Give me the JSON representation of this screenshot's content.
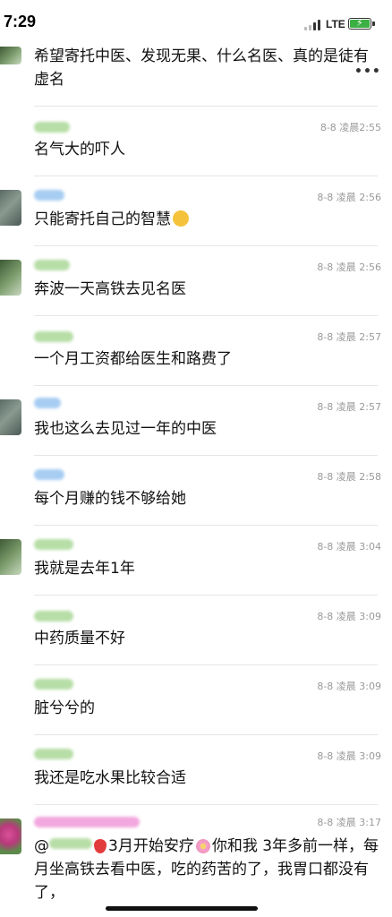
{
  "status_bar": {
    "time": "7:29",
    "network": "LTE"
  },
  "menu": {
    "more_label": "•••"
  },
  "messages": [
    {
      "avatar": "green",
      "sender_color": "",
      "timestamp": "",
      "text": "希望寄托中医、发现无果、什么名医、真的是徒有虚名"
    },
    {
      "avatar": "none",
      "sender_color": "green",
      "timestamp": "8-8 凌晨2:55",
      "text": "名气大的吓人"
    },
    {
      "avatar": "rock",
      "sender_color": "blue",
      "timestamp": "8-8 凌晨 2:56",
      "text": "只能寄托自己的智慧",
      "emoji": "thinking-face"
    },
    {
      "avatar": "green",
      "sender_color": "green",
      "timestamp": "8-8 凌晨 2:56",
      "text": "奔波一天高铁去见名医"
    },
    {
      "avatar": "none",
      "sender_color": "green",
      "timestamp": "8-8 凌晨 2:57",
      "text": "一个月工资都给医生和路费了"
    },
    {
      "avatar": "rock",
      "sender_color": "blue",
      "timestamp": "8-8 凌晨 2:57",
      "text": "我也这么去见过一年的中医"
    },
    {
      "avatar": "none",
      "sender_color": "blue",
      "timestamp": "8-8 凌晨 2:58",
      "text": "每个月赚的钱不够给她"
    },
    {
      "avatar": "green",
      "sender_color": "green",
      "timestamp": "8-8 凌晨 3:04",
      "text": "我就是去年1年"
    },
    {
      "avatar": "none",
      "sender_color": "green",
      "timestamp": "8-8 凌晨 3:09",
      "text": "中药质量不好"
    },
    {
      "avatar": "none",
      "sender_color": "green",
      "timestamp": "8-8 凌晨 3:09",
      "text": "脏兮兮的"
    },
    {
      "avatar": "none",
      "sender_color": "green",
      "timestamp": "8-8 凌晨 3:09",
      "text": "我还是吃水果比较合适"
    },
    {
      "avatar": "flower",
      "sender_color": "pink",
      "timestamp": "8-8 凌晨 3:17",
      "text_part1": "@",
      "text_part2": "3月开始安疗",
      "text_part3": "你和我 3年多前一样，每月坐高铁去看中医，吃的药苦的了，我胃口都没有了，"
    }
  ]
}
